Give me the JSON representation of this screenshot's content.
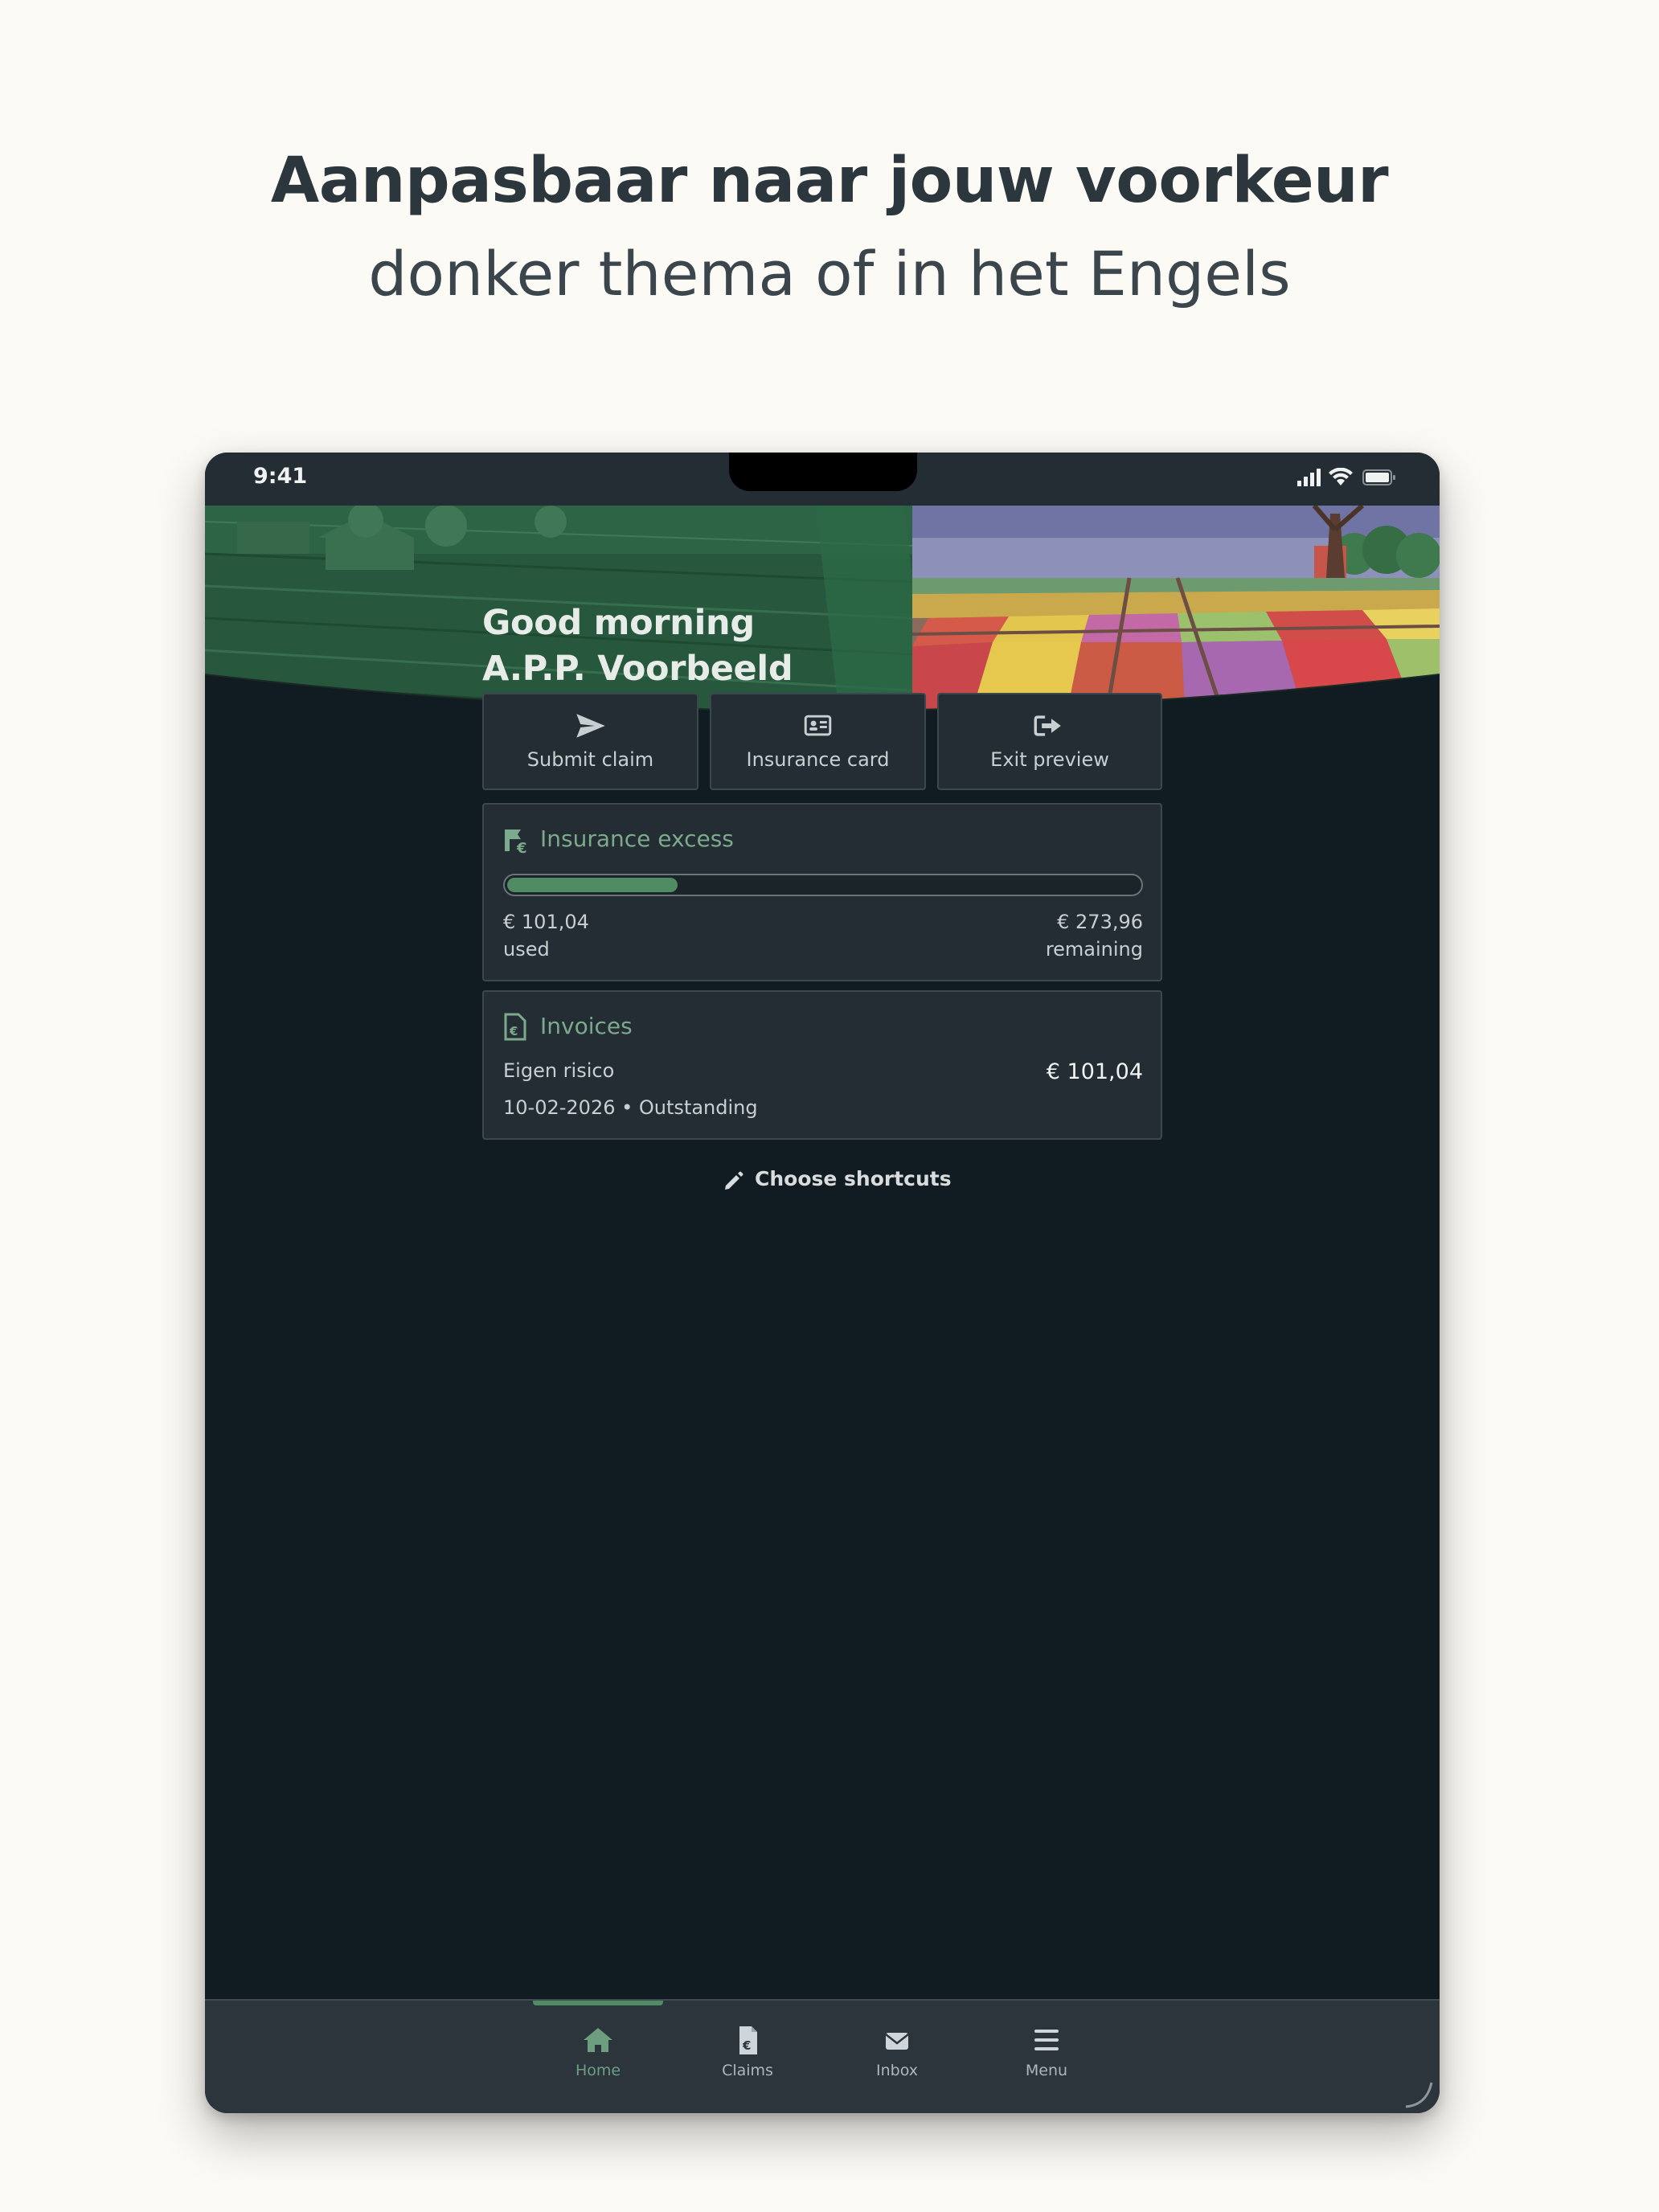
{
  "headline": "Aanpasbaar naar jouw voorkeur",
  "subheadline": "donker thema of in het Engels",
  "status_bar": {
    "time": "9:41"
  },
  "greeting": {
    "line1": "Good morning",
    "line2": "A.P.P. Voorbeeld"
  },
  "actions": [
    {
      "label": "Submit claim",
      "icon": "paper-plane-icon"
    },
    {
      "label": "Insurance card",
      "icon": "id-card-icon"
    },
    {
      "label": "Exit preview",
      "icon": "sign-out-icon"
    }
  ],
  "excess": {
    "title": "Insurance excess",
    "used_amount": "€ 101,04",
    "used_label": "used",
    "remaining_amount": "€ 273,96",
    "remaining_label": "remaining",
    "progress_fraction": 0.27
  },
  "invoices": {
    "title": "Invoices",
    "item_name": "Eigen risico",
    "item_meta": "10-02-2026 • Outstanding",
    "item_amount": "€ 101,04"
  },
  "shortcuts_label": "Choose shortcuts",
  "tabs": [
    {
      "label": "Home",
      "icon": "home-icon",
      "active": true
    },
    {
      "label": "Claims",
      "icon": "claims-document-icon",
      "active": false
    },
    {
      "label": "Inbox",
      "icon": "envelope-icon",
      "active": false
    },
    {
      "label": "Menu",
      "icon": "hamburger-menu-icon",
      "active": false
    }
  ],
  "colors": {
    "background": "#fcfaf5",
    "app_background": "#111c22",
    "card": "#232d33",
    "accent_green": "#4f8b63",
    "accent_text": "#7da98c"
  }
}
